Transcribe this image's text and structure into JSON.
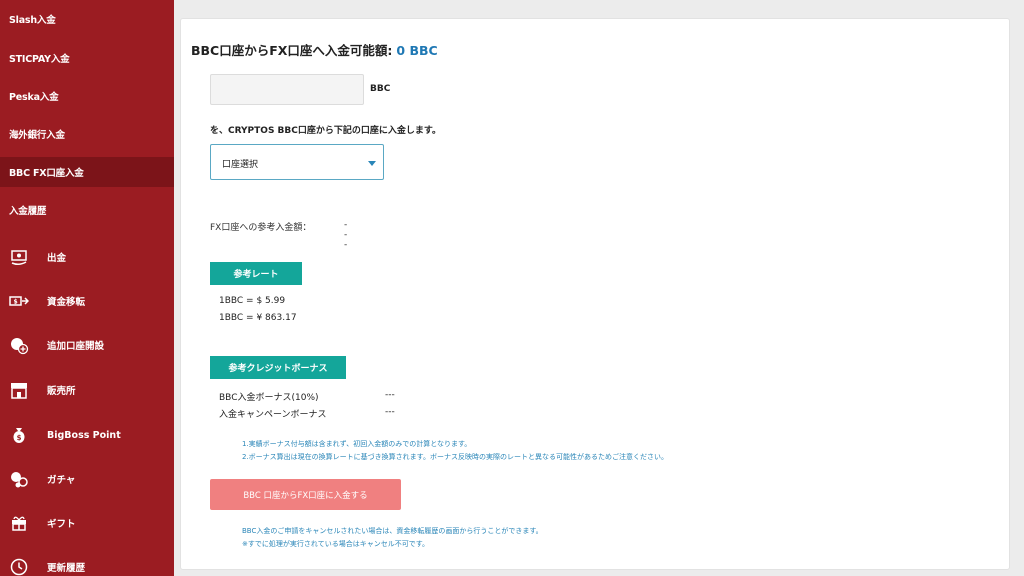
{
  "sidebar": {
    "text_items": [
      {
        "label": "Slash入金",
        "active": false
      },
      {
        "label": "STICPAY入金",
        "active": false
      },
      {
        "label": "Peska入金",
        "active": false
      },
      {
        "label": "海外銀行入金",
        "active": false
      },
      {
        "label": "BBC FX口座入金",
        "active": true
      },
      {
        "label": "入金履歴",
        "active": false
      }
    ],
    "icon_items": [
      {
        "label": "出金",
        "icon": "withdraw-icon"
      },
      {
        "label": "資金移転",
        "icon": "transfer-icon"
      },
      {
        "label": "追加口座開設",
        "icon": "add-account-icon"
      },
      {
        "label": "販売所",
        "icon": "shop-icon"
      },
      {
        "label": "BigBoss Point",
        "icon": "point-icon"
      },
      {
        "label": "ガチャ",
        "icon": "gacha-icon"
      },
      {
        "label": "ギフト",
        "icon": "gift-icon"
      },
      {
        "label": "更新履歴",
        "icon": "history-icon"
      }
    ]
  },
  "main": {
    "title": "BBC口座からFX口座へ入金可能額:",
    "available_amount": "0 BBC",
    "amount_input": {
      "value": "",
      "unit": "BBC"
    },
    "instruction": "を、CRYPTOS BBC口座から下記の口座に入金します。",
    "account_select": {
      "selected": "口座選択"
    },
    "reference_amount": {
      "label": "FX口座への参考入金額：",
      "value": "---"
    },
    "rate_section": {
      "heading": "参考レート",
      "rates": [
        "1BBC = $ 5.99",
        "1BBC = ¥ 863.17"
      ]
    },
    "bonus_section": {
      "heading": "参考クレジットボーナス",
      "rows": [
        {
          "label": "BBC入金ボーナス(10%)",
          "value": "---"
        },
        {
          "label": "入金キャンペーンボーナス",
          "value": "---"
        }
      ]
    },
    "notes": [
      "1.実績ボーナス付与額は含まれず、初回入金額のみでの計算となります。",
      "2.ボーナス算出は現在の換算レートに基づき換算されます。ボーナス反映時の実際のレートと異なる可能性があるためご注意ください。"
    ],
    "submit_label": "BBC 口座からFX口座に入金する",
    "cancel_notes": [
      "BBC入金のご申請をキャンセルされたい場合は、資金移転履歴の画面から行うことができます。",
      "※すでに処理が実行されている場合はキャンセル不可です。"
    ]
  },
  "colors": {
    "sidebar_bg": "#9b1c22",
    "sidebar_active": "#7c1419",
    "accent_teal": "#14a69a",
    "link_blue": "#1f78b4",
    "button_salmon": "#f08080"
  }
}
